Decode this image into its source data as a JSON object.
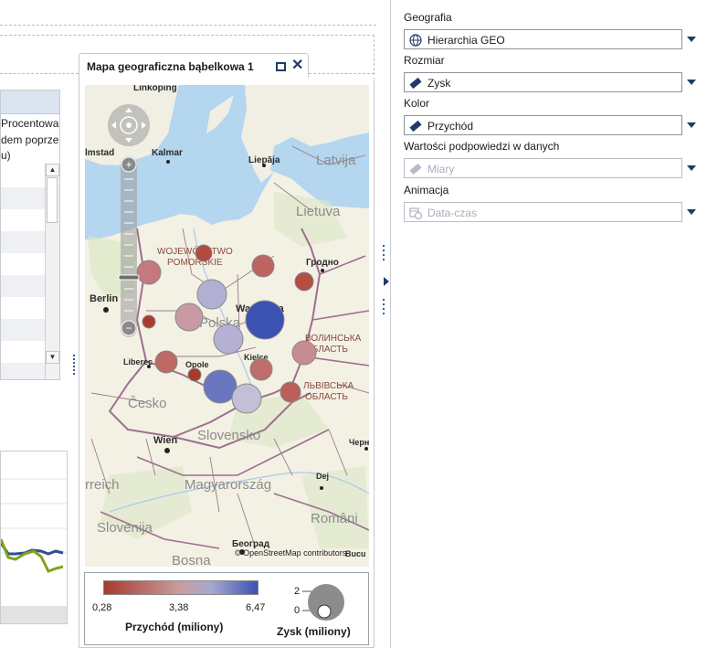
{
  "left_fragment": {
    "table_header_lines": [
      "Procentowa",
      "dem poprze",
      "u)"
    ]
  },
  "map_panel": {
    "title": "Mapa geograficzna bąbelkowa 1",
    "attribution": "© OpenStreetMap contributors",
    "place_labels": {
      "linkoping": "Linköping",
      "halmstad": "lmstad",
      "kalmar": "Kalmar",
      "liepaja": "Liepāja",
      "latvija": "Latvija",
      "lietuva": "Lietuva",
      "pomorskie1": "WOJEWÓDZTWO",
      "pomorskie2": "POMORSKIE",
      "grodno": "Гродно",
      "berlin": "Berlin",
      "warszawa": "Warszawa",
      "polska": "Polska",
      "volyn1": "ВОЛИНСЬКА",
      "volyn2": "ОБЛАСТЬ",
      "liberec": "Liberec",
      "opole": "Opole",
      "kielce": "Kielce",
      "lviv1": "ЛЬВІВСЬКА",
      "lviv2": "ОБЛАСТЬ",
      "cesko": "Česko",
      "wien": "Wien",
      "slovensko": "Slovensko",
      "cherniv": "Черн",
      "osterreich": "rreich",
      "magyarorszag": "Magyarország",
      "dej": "Dej",
      "slovenija": "Slovenija",
      "beograd": "Београд",
      "romania": "Români",
      "bosna": "Bosna",
      "bucu": "Bucu"
    },
    "bubbles": [
      {
        "id": "b1",
        "revenue": 0.6,
        "color": "#b24a3f"
      },
      {
        "id": "b2",
        "revenue": 1.8,
        "color": "#c27a7e"
      },
      {
        "id": "b3",
        "revenue": 1.3,
        "color": "#bb6461"
      },
      {
        "id": "b4",
        "revenue": 0.7,
        "color": "#b54d43"
      },
      {
        "id": "b5",
        "revenue": 3.9,
        "color": "#b2afd3"
      },
      {
        "id": "b6",
        "revenue": 6.47,
        "color": "#3c52b3"
      },
      {
        "id": "b7",
        "revenue": 0.3,
        "color": "#a93b2e"
      },
      {
        "id": "b8",
        "revenue": 2.4,
        "color": "#c99aa4"
      },
      {
        "id": "b9",
        "revenue": 3.8,
        "color": "#b4b1d4"
      },
      {
        "id": "b10",
        "revenue": 2.2,
        "color": "#c68c93"
      },
      {
        "id": "b11",
        "revenue": 1.4,
        "color": "#bd6966"
      },
      {
        "id": "b12",
        "revenue": 0.28,
        "color": "#a83a2c"
      },
      {
        "id": "b13",
        "revenue": 1.5,
        "color": "#be6e6c"
      },
      {
        "id": "b14",
        "revenue": 5.4,
        "color": "#6b76c0"
      },
      {
        "id": "b15",
        "revenue": 3.4,
        "color": "#c4bfd6"
      },
      {
        "id": "b16",
        "revenue": 1.2,
        "color": "#ba5f5b"
      }
    ]
  },
  "legend": {
    "color_title": "Przychód  (miliony)",
    "color_min": "0,28",
    "color_mid": "3,38",
    "color_max": "6,47",
    "size_title": "Zysk  (miliony)",
    "size_max": "2",
    "size_min": "0"
  },
  "properties": {
    "geography_label": "Geografia",
    "geography_value": "Hierarchia GEO",
    "size_label": "Rozmiar",
    "size_value": "Zysk",
    "color_label": "Kolor",
    "color_value": "Przychód",
    "datatips_label": "Wartości podpowiedzi w danych",
    "datatips_value": "Miary",
    "animation_label": "Animacja",
    "animation_value": "Data-czas"
  },
  "colors": {
    "accent": "#1f3b66",
    "water": "#b4d6ee",
    "land": "#f3f0e4",
    "border": "#9c6f8f"
  },
  "icons": {
    "geography": "globe-icon",
    "size": "measure-icon",
    "color": "measure-icon",
    "datatips": "measure-icon",
    "animation": "calendar-clock-icon"
  }
}
